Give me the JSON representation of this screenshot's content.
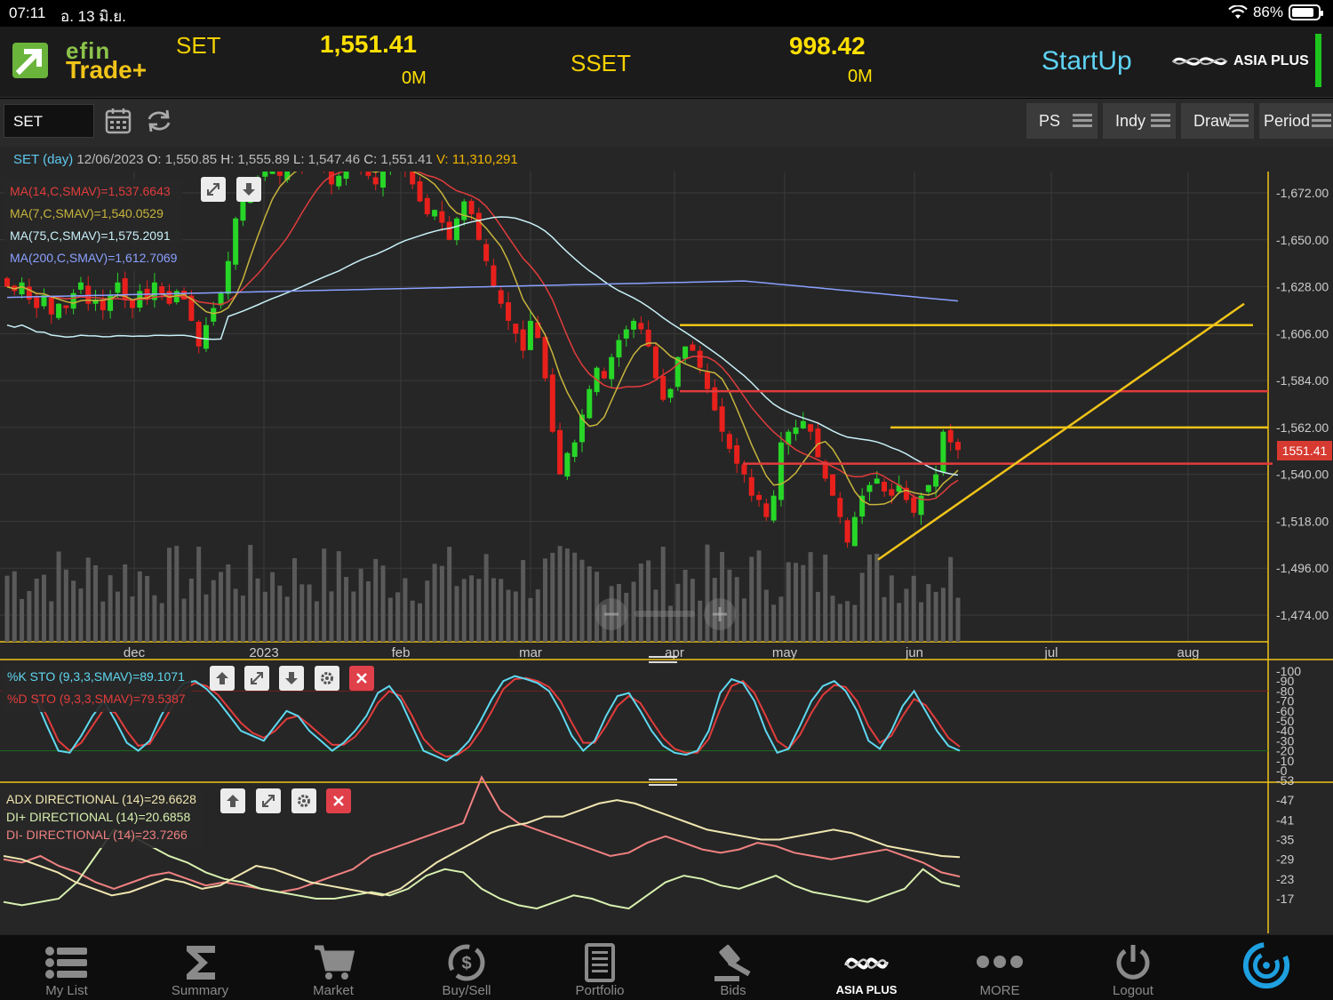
{
  "status_bar": {
    "time": "07:11",
    "date": "อ. 13 มิ.ย.",
    "battery": "86%"
  },
  "header": {
    "app_logo_line1": "efin",
    "app_logo_line2": "Trade+",
    "index1": {
      "name": "SET",
      "value": "1,551.41",
      "volume": "0M"
    },
    "index2": {
      "name": "SSET",
      "value": "998.42",
      "volume": "0M"
    },
    "startup_label": "StartUp",
    "broker_logo": "ASIA PLUS",
    "colors": {
      "index": "#ffe000",
      "startup": "#5fd3f3"
    }
  },
  "toolbar": {
    "symbol": "SET",
    "buttons": [
      "PS",
      "Indy",
      "Draw",
      "Period"
    ],
    "icons": [
      "calendar-icon",
      "refresh-icon"
    ]
  },
  "info_line": {
    "symbol": "SET (day)",
    "date": "12/06/2023",
    "open_label": "O:",
    "open": "1,550.85",
    "high_label": "H:",
    "high": "1,555.89",
    "low_label": "L:",
    "low": "1,547.46",
    "close_label": "C:",
    "close": "1,551.41",
    "volume_label": "V:",
    "volume": "11,310,291"
  },
  "price_panel": {
    "legend": [
      {
        "text": "MA(14,C,SMAV)=1,537.6643",
        "color": "#e23c3c"
      },
      {
        "text": "MA(7,C,SMAV)=1,540.0529",
        "color": "#c8b43c"
      },
      {
        "text": "MA(75,C,SMAV)=1,575.2091",
        "color": "#c8f0f8"
      },
      {
        "text": "MA(200,C,SMAV)=1,612.7069",
        "color": "#8aa0ff"
      }
    ],
    "y_ticks": [
      "1,672.00",
      "1,650.00",
      "1,628.00",
      "1,606.00",
      "1,584.00",
      "1,562.00",
      "1,540.00",
      "1,518.00",
      "1,496.00",
      "1,474.00"
    ],
    "x_ticks": [
      "dec",
      "2023",
      "feb",
      "mar",
      "apr",
      "may",
      "jun",
      "jul",
      "aug"
    ],
    "last_price": "1551.41"
  },
  "sto_panel": {
    "legend": [
      {
        "text": "%K STO (9,3,3,SMAV)=89.1071",
        "color": "#5fd8f0"
      },
      {
        "text": "%D STO (9,3,3,SMAV)=79.5387",
        "color": "#e23c3c"
      }
    ],
    "y_ticks": [
      "100",
      "90",
      "80",
      "70",
      "60",
      "50",
      "40",
      "30",
      "20",
      "10",
      "0"
    ]
  },
  "adx_panel": {
    "legend": [
      {
        "text": "ADX DIRECTIONAL (14)=29.6628",
        "color": "#f0e6b0"
      },
      {
        "text": "DI+ DIRECTIONAL (14)=20.6858",
        "color": "#d8f0b0"
      },
      {
        "text": "DI- DIRECTIONAL (14)=23.7266",
        "color": "#f08080"
      }
    ],
    "y_ticks": [
      "53",
      "47",
      "41",
      "35",
      "29",
      "23",
      "17"
    ]
  },
  "chart_data": [
    {
      "type": "candlestick",
      "title": "SET (day)",
      "x_range": [
        "2022-11-08",
        "2023-08-31"
      ],
      "ylim": [
        1465,
        1680
      ],
      "x_ticks": [
        "dec",
        "2023",
        "feb",
        "mar",
        "apr",
        "may",
        "jun",
        "jul",
        "aug"
      ],
      "close_series": [
        1628,
        1626,
        1630,
        1622,
        1618,
        1624,
        1615,
        1620,
        1618,
        1625,
        1630,
        1620,
        1622,
        1617,
        1624,
        1630,
        1622,
        1618,
        1626,
        1622,
        1630,
        1624,
        1620,
        1626,
        1622,
        1612,
        1600,
        1610,
        1618,
        1625,
        1640,
        1660,
        1668,
        1672,
        1678,
        1682,
        1684,
        1680,
        1686,
        1690,
        1684,
        1688,
        1690,
        1682,
        1676,
        1680,
        1686,
        1690,
        1684,
        1680,
        1676,
        1682,
        1688,
        1690,
        1684,
        1676,
        1668,
        1662,
        1664,
        1658,
        1650,
        1660,
        1668,
        1662,
        1650,
        1640,
        1628,
        1620,
        1612,
        1606,
        1598,
        1612,
        1604,
        1585,
        1560,
        1540,
        1550,
        1555,
        1568,
        1580,
        1590,
        1585,
        1595,
        1603,
        1608,
        1612,
        1608,
        1600,
        1585,
        1575,
        1580,
        1595,
        1600,
        1598,
        1590,
        1580,
        1570,
        1560,
        1552,
        1545,
        1540,
        1530,
        1528,
        1520,
        1530,
        1555,
        1560,
        1562,
        1565,
        1560,
        1548,
        1538,
        1530,
        1520,
        1508,
        1520,
        1530,
        1535,
        1538,
        1532,
        1530,
        1535,
        1528,
        1522,
        1530,
        1535,
        1540,
        1560,
        1555,
        1551.41
      ],
      "horizontal_lines": [
        {
          "value": 1610,
          "color": "#f0c419"
        },
        {
          "value": 1579,
          "color": "#e23c3c"
        },
        {
          "value": 1562,
          "color": "#f0c419"
        },
        {
          "value": 1545,
          "color": "#e23c3c"
        }
      ],
      "trendline": {
        "from": [
          1500,
          "2023-05-24"
        ],
        "to": [
          1620,
          "2023-08-15"
        ],
        "color": "#f0c419"
      }
    },
    {
      "type": "line",
      "title": "STO (9,3,3,SMAV)",
      "ylim": [
        0,
        100
      ],
      "series": [
        {
          "name": "%K",
          "values": [
            72,
            45,
            20,
            18,
            35,
            55,
            70,
            50,
            28,
            20,
            30,
            55,
            75,
            88,
            90,
            82,
            70,
            55,
            40,
            35,
            30,
            45,
            60,
            55,
            40,
            30,
            20,
            28,
            40,
            55,
            78,
            85,
            70,
            45,
            20,
            15,
            10,
            18,
            30,
            50,
            72,
            90,
            95,
            92,
            88,
            80,
            60,
            35,
            20,
            30,
            55,
            75,
            78,
            60,
            40,
            25,
            18,
            16,
            20,
            40,
            78,
            92,
            88,
            70,
            40,
            18,
            22,
            45,
            70,
            85,
            90,
            80,
            60,
            30,
            22,
            40,
            65,
            80,
            60,
            40,
            25,
            20
          ]
        },
        {
          "name": "%D",
          "values": [
            75,
            55,
            30,
            20,
            28,
            45,
            62,
            58,
            40,
            25,
            27,
            45,
            65,
            82,
            88,
            85,
            76,
            62,
            48,
            38,
            33,
            40,
            52,
            55,
            46,
            36,
            26,
            26,
            34,
            48,
            68,
            80,
            75,
            55,
            32,
            20,
            14,
            16,
            24,
            40,
            60,
            82,
            92,
            93,
            90,
            84,
            70,
            48,
            28,
            28,
            45,
            65,
            75,
            68,
            50,
            33,
            22,
            18,
            18,
            32,
            62,
            85,
            90,
            78,
            55,
            30,
            22,
            36,
            58,
            76,
            86,
            84,
            70,
            45,
            28,
            35,
            55,
            72,
            66,
            50,
            33,
            24
          ]
        }
      ]
    },
    {
      "type": "line",
      "title": "ADX DIRECTIONAL (14)",
      "ylim": [
        12,
        56
      ],
      "series": [
        {
          "name": "ADX",
          "values": [
            30,
            29,
            27,
            25,
            22,
            20,
            18,
            19,
            21,
            23,
            22,
            20,
            21,
            24,
            27,
            26,
            24,
            22,
            21,
            20,
            19,
            18,
            20,
            24,
            28,
            31,
            34,
            37,
            39,
            40,
            42,
            42,
            44,
            46,
            47,
            46,
            44,
            42,
            40,
            38,
            37,
            36,
            35,
            35,
            36,
            37,
            38,
            37,
            35,
            33,
            32,
            31,
            30,
            29.66
          ]
        },
        {
          "name": "DI+",
          "values": [
            16,
            15,
            16,
            17,
            22,
            30,
            38,
            36,
            33,
            30,
            28,
            25,
            23,
            22,
            20,
            19,
            18,
            17,
            17,
            18,
            19,
            18,
            20,
            24,
            26,
            25,
            20,
            17,
            15,
            14,
            16,
            18,
            17,
            15,
            14,
            18,
            22,
            24,
            23,
            21,
            20,
            22,
            24,
            21,
            19,
            18,
            17,
            16,
            18,
            20,
            26,
            22,
            20.69
          ]
        },
        {
          "name": "DI-",
          "values": [
            29,
            28,
            30,
            27,
            25,
            22,
            20,
            22,
            24,
            25,
            23,
            21,
            22,
            21,
            20,
            19,
            20,
            22,
            24,
            26,
            30,
            32,
            34,
            36,
            38,
            40,
            54,
            44,
            40,
            38,
            36,
            34,
            32,
            30,
            31,
            34,
            36,
            34,
            32,
            31,
            32,
            34,
            33,
            31,
            30,
            29,
            30,
            31,
            32,
            30,
            28,
            25,
            23.73
          ]
        }
      ]
    }
  ],
  "bottom_nav": [
    {
      "label": "My List",
      "icon": "list-icon"
    },
    {
      "label": "Summary",
      "icon": "sigma-icon"
    },
    {
      "label": "Market",
      "icon": "cart-icon"
    },
    {
      "label": "Buy/Sell",
      "icon": "exchange-icon"
    },
    {
      "label": "Portfolio",
      "icon": "portfolio-icon"
    },
    {
      "label": "Bids",
      "icon": "gavel-icon"
    },
    {
      "label": "ASIA PLUS",
      "icon": "asiaplus-icon"
    },
    {
      "label": "MORE",
      "icon": "more-icon"
    },
    {
      "label": "Logout",
      "icon": "power-icon"
    }
  ]
}
